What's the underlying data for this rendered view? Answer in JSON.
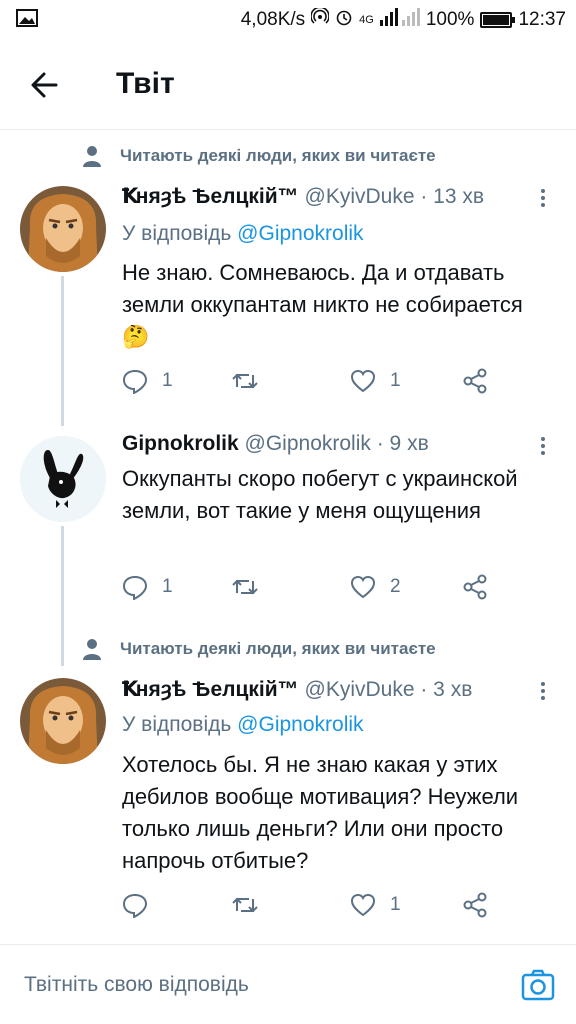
{
  "status_bar": {
    "net_speed": "4,08K/s",
    "network": "4G",
    "battery": "100%",
    "battery_level": 1.0,
    "time": "12:37",
    "icons": [
      "image-icon",
      "hotspot-icon",
      "alarm-icon",
      "signal-icon",
      "battery-icon"
    ]
  },
  "header": {
    "title": "Твіт",
    "back_icon": "back-arrow-icon"
  },
  "tweets": [
    {
      "social_context": "Читають деякі люди, яких ви читаєте",
      "name": "Ꝁняȝѣ Ѣелцкій™",
      "handle": "@KyivDuke",
      "time": "· 13 хв",
      "reply_prefix": "У відповідь",
      "reply_handle": "@Gipnokrolik",
      "text": "Не знаю. Сомневаюсь. Да и отдавать земли оккупантам никто не собирается 🤔",
      "replies": "1",
      "retweets": "",
      "likes": "1"
    },
    {
      "social_context": "",
      "name": "Gipnokrolik",
      "handle": "@Gipnokrolik",
      "time": "· 9 хв",
      "reply_prefix": "",
      "reply_handle": "",
      "text": "Оккупанты скоро побегут с украинской земли, вот такие у меня ощущения",
      "replies": "1",
      "retweets": "",
      "likes": "2"
    },
    {
      "social_context": "Читають деякі люди, яких ви читаєте",
      "name": "Ꝁняȝѣ Ѣелцкій™",
      "handle": "@KyivDuke",
      "time": "· 3 хв",
      "reply_prefix": "У відповідь",
      "reply_handle": "@Gipnokrolik",
      "text": "Хотелось бы. Я не знаю какая у этих дебилов вообще мотивация? Неужели только лишь деньги? Или они просто напрочь отбитые?",
      "replies": "",
      "retweets": "",
      "likes": "1"
    }
  ],
  "composer": {
    "placeholder": "Твітніть свою відповідь",
    "camera_icon": "camera-icon"
  },
  "colors": {
    "accent": "#1b95e0",
    "secondary_text": "#5b7083",
    "divider": "#e6ecf0"
  }
}
